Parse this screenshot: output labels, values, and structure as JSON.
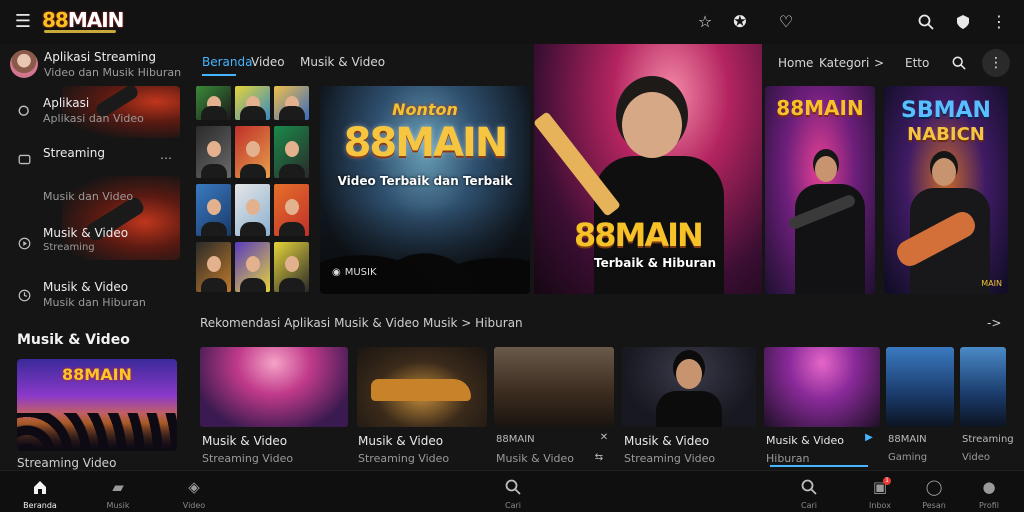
{
  "header": {
    "logo_num": "88",
    "logo_text": "MAIN",
    "icons": [
      "menu-icon",
      "star-icon",
      "badge-icon",
      "heart-icon",
      "search-icon",
      "shield-icon",
      "more-vert-icon"
    ]
  },
  "sidebar": {
    "profile": {
      "title": "Aplikasi Streaming",
      "subtitle": "Video dan Musik Hiburan"
    },
    "items": [
      {
        "icon": "search-icon",
        "label": "Aplikasi",
        "sub": "Aplikasi dan Video"
      },
      {
        "icon": "camera-icon",
        "label": "Streaming",
        "sub": ""
      },
      {
        "icon": "mic-icon",
        "label": "",
        "sub": "Musik dan Video"
      },
      {
        "icon": "play-icon",
        "label": "Musik & Video",
        "sub": "Streaming"
      },
      {
        "icon": "clock-icon",
        "label": "Musik & Video",
        "sub": "Musik dan Hiburan"
      }
    ],
    "section_title": "Musik & Video",
    "card_title": "88MAIN",
    "card_caption": "Streaming Video"
  },
  "tabs": [
    {
      "label": "Beranda",
      "active": true
    },
    {
      "label": "Video",
      "active": false
    },
    {
      "label": "Musik & Video",
      "active": false
    }
  ],
  "top_nav": {
    "home": "Home",
    "category": "Kategori",
    "category_arrow": ">",
    "extra": "Etto"
  },
  "hero": {
    "banner1_line1": "Nonton",
    "banner1_title": "88MAIN",
    "banner1_subtitle": "Video Terbaik dan Terbaik",
    "banner1_brand": "MUSIK",
    "banner2_title": "88MAIN",
    "banner2_subtitle": "Terbaik & Hiburan",
    "banner3_title": "88MAIN",
    "banner4_title": "SBMAN",
    "banner4_subtitle": "NABICN",
    "banner4_tag": "MAIN"
  },
  "section": {
    "title": "Rekomendasi Aplikasi Musik & Video Musik > Hiburan",
    "arrow": "->"
  },
  "cards": [
    {
      "title": "Musik & Video",
      "sub": "Streaming Video"
    },
    {
      "title": "Musik & Video",
      "sub": "Streaming Video"
    },
    {
      "title": "88MAIN",
      "sub": "Musik & Video"
    },
    {
      "title": "Musik & Video",
      "sub": "Streaming Video"
    },
    {
      "title": "Musik & Video",
      "sub": "Hiburan"
    },
    {
      "title": "88MAIN",
      "sub": "Gaming"
    },
    {
      "title": "Streaming",
      "sub": "Video"
    }
  ],
  "bottom_nav": [
    {
      "icon": "home-icon",
      "label": "Beranda",
      "active": true
    },
    {
      "icon": "shorts-icon",
      "label": "Musik",
      "active": false
    },
    {
      "icon": "explore-icon",
      "label": "Video",
      "active": false
    },
    {
      "icon": "search-icon",
      "label": "Cari",
      "active": false
    },
    {
      "icon": "search-icon",
      "label": "Cari",
      "active": false
    },
    {
      "icon": "inbox-icon",
      "label": "Inbox",
      "active": false,
      "badge": "1"
    },
    {
      "icon": "chat-icon",
      "label": "Pesan",
      "active": false
    },
    {
      "icon": "profile-icon",
      "label": "Profil",
      "active": false
    }
  ]
}
